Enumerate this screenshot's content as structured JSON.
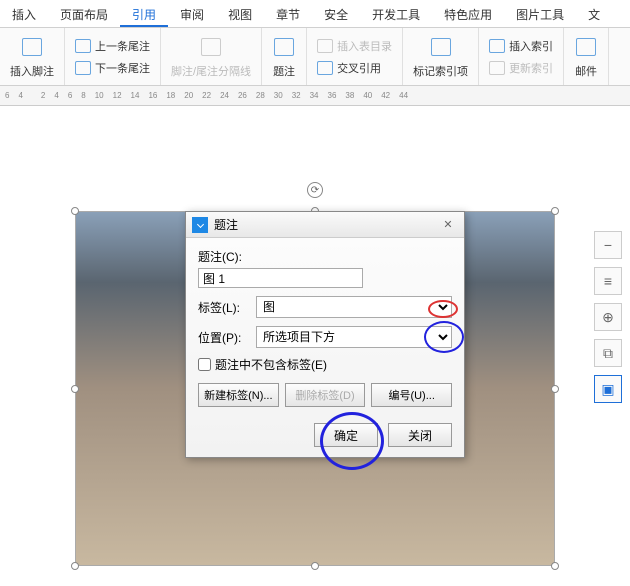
{
  "tabs": {
    "items": [
      "插入",
      "页面布局",
      "引用",
      "审阅",
      "视图",
      "章节",
      "安全",
      "开发工具",
      "特色应用",
      "图片工具",
      "文"
    ],
    "activeIndex": 2
  },
  "ribbon": {
    "insert_footnote": "插入脚注",
    "prev_endnote": "上一条尾注",
    "next_endnote": "下一条尾注",
    "footnote_sep": "脚注/尾注分隔线",
    "caption": "题注",
    "insert_tof": "插入表目录",
    "cross_ref": "交叉引用",
    "mark_index": "标记索引项",
    "insert_index": "插入索引",
    "update_index": "更新索引",
    "mail": "邮件"
  },
  "ruler": [
    "6",
    "4",
    "",
    "2",
    "4",
    "6",
    "8",
    "10",
    "12",
    "14",
    "16",
    "18",
    "20",
    "22",
    "24",
    "26",
    "28",
    "30",
    "32",
    "34",
    "36",
    "38",
    "40",
    "42",
    "44"
  ],
  "side_tools": [
    "−",
    "≡",
    "⊕",
    "⧉",
    "▣"
  ],
  "dialog": {
    "title": "题注",
    "caption_label": "题注(C):",
    "caption_value": "图 1",
    "label_label": "标签(L):",
    "label_options": [
      "图"
    ],
    "position_label": "位置(P):",
    "position_options": [
      "所选项目下方"
    ],
    "exclude_label": "题注中不包含标签(E)",
    "new_label": "新建标签(N)...",
    "delete_label": "删除标签(D)",
    "numbering": "编号(U)...",
    "ok": "确定",
    "close": "关闭",
    "close_x": "✕"
  }
}
